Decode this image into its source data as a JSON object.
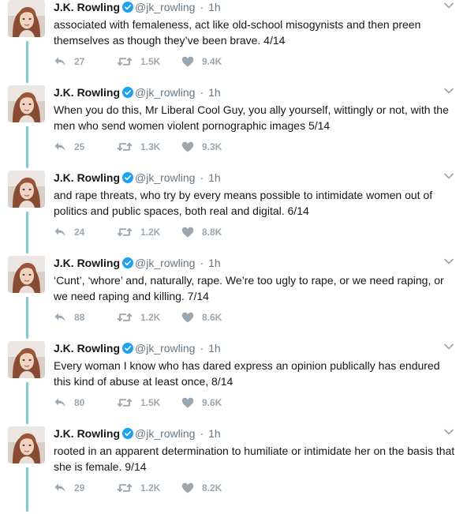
{
  "colors": {
    "thread_line": "#7fcbd4",
    "verified": "#1da1f2",
    "secondary_text": "#657786",
    "action_icons": "#9aa7b1"
  },
  "icons": {
    "reply": "reply-icon",
    "retweet": "retweet-icon",
    "like": "heart-icon",
    "verified": "verified-badge-icon",
    "more": "chevron-down-icon"
  },
  "tweets": [
    {
      "name": "J.K. Rowling",
      "handle": "@jk_rowling",
      "separator": "·",
      "time": "1h",
      "text": "associated with femaleness, act like old-school misogynists and then preen themselves as though they’ve been brave. 4/14",
      "replies": "27",
      "retweets": "1.5K",
      "likes": "9.4K"
    },
    {
      "name": "J.K. Rowling",
      "handle": "@jk_rowling",
      "separator": "·",
      "time": "1h",
      "text": "When you do this, Mr Liberal Cool Guy, you ally yourself, wittingly or not, with the men who send women violent pornographic images 5/14",
      "replies": "25",
      "retweets": "1.3K",
      "likes": "9.3K"
    },
    {
      "name": "J.K. Rowling",
      "handle": "@jk_rowling",
      "separator": "·",
      "time": "1h",
      "text": "and rape threats, who try by every means possible to intimidate women out of politics and public spaces, both real and digital. 6/14",
      "replies": "24",
      "retweets": "1.2K",
      "likes": "8.8K"
    },
    {
      "name": "J.K. Rowling",
      "handle": "@jk_rowling",
      "separator": "·",
      "time": "1h",
      "text": "‘Cunt’, ‘whore’ and, naturally, rape. We’re too ugly to rape, or we need raping, or we need raping and killing. 7/14",
      "replies": "88",
      "retweets": "1.2K",
      "likes": "8.6K"
    },
    {
      "name": "J.K. Rowling",
      "handle": "@jk_rowling",
      "separator": "·",
      "time": "1h",
      "text": "Every woman I know who has dared express an opinion publically has endured this kind of abuse at least once, 8/14",
      "replies": "80",
      "retweets": "1.5K",
      "likes": "9.6K"
    },
    {
      "name": "J.K. Rowling",
      "handle": "@jk_rowling",
      "separator": "·",
      "time": "1h",
      "text": "rooted in an apparent determination to humiliate or intimidate her on the basis that she is female. 9/14",
      "replies": "29",
      "retweets": "1.2K",
      "likes": "8.2K"
    }
  ]
}
